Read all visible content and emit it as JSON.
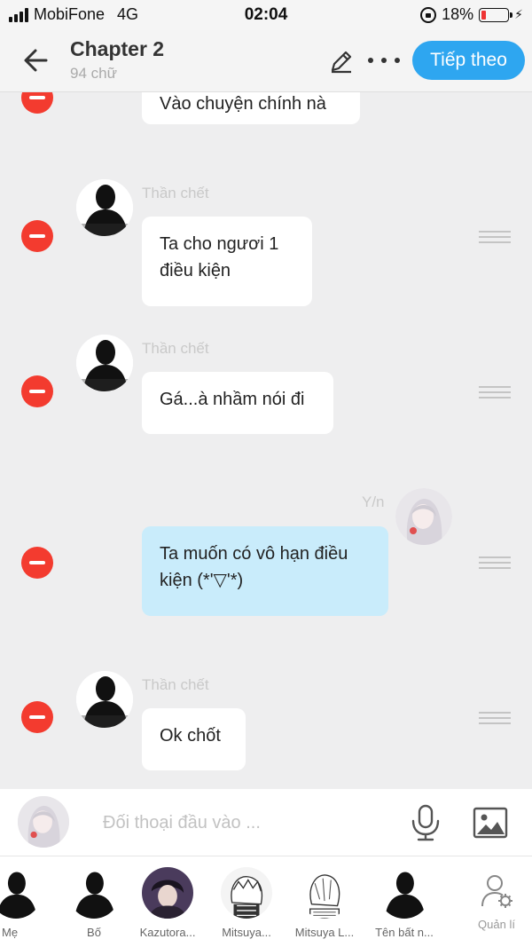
{
  "status_bar": {
    "carrier": "MobiFone",
    "network": "4G",
    "time": "02:04",
    "battery": "18%"
  },
  "header": {
    "title": "Chapter 2",
    "word_count": "94 chữ",
    "next_label": "Tiếp theo"
  },
  "messages": [
    {
      "speaker": "",
      "text": "Vào chuyện chính nà",
      "side": "left"
    },
    {
      "speaker": "Thần chết",
      "text": "Ta cho ngươi 1 điều kiện",
      "side": "left"
    },
    {
      "speaker": "Thần chết",
      "text": "Gá...à nhầm nói đi",
      "side": "left"
    },
    {
      "speaker": "Y/n",
      "text": "Ta muốn có vô hạn điều kiện (*'▽'*)",
      "side": "right"
    },
    {
      "speaker": "Thần chết",
      "text": "Ok chốt",
      "side": "left"
    }
  ],
  "input": {
    "placeholder": "Đối thoại đầu vào ..."
  },
  "characters": [
    {
      "name": "Mẹ"
    },
    {
      "name": "Bố"
    },
    {
      "name": "Kazutora..."
    },
    {
      "name": "Mitsuya..."
    },
    {
      "name": "Mitsuya L..."
    },
    {
      "name": "Tên bất n..."
    }
  ],
  "manage_label": "Quản lí",
  "colors": {
    "accent": "#2ea6f0",
    "delete": "#f33b2f",
    "my_bubble": "#c9ecfb",
    "battery_low": "#e33333"
  },
  "icons": [
    "back-arrow-icon",
    "pencil-icon",
    "more-dots-icon",
    "microphone-icon",
    "image-icon",
    "manage-user-gear-icon"
  ]
}
